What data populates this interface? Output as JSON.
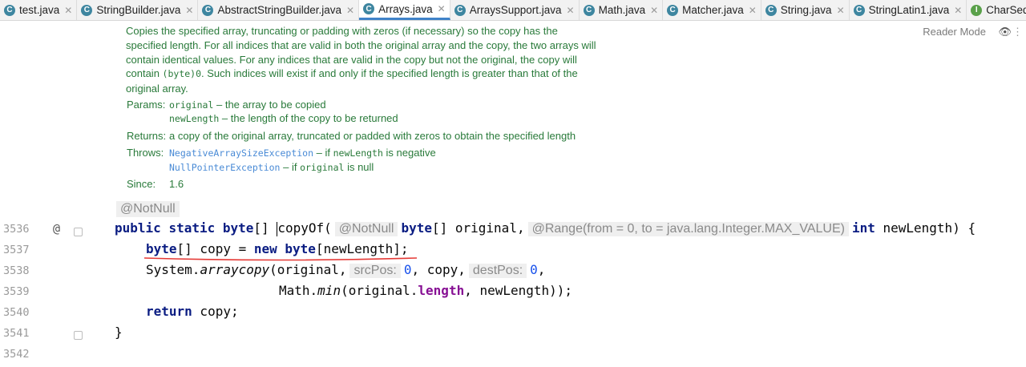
{
  "tabs": [
    {
      "label": "test.java",
      "icon": "C",
      "active": false
    },
    {
      "label": "StringBuilder.java",
      "icon": "C",
      "active": false
    },
    {
      "label": "AbstractStringBuilder.java",
      "icon": "C",
      "active": false
    },
    {
      "label": "Arrays.java",
      "icon": "C",
      "active": true
    },
    {
      "label": "ArraysSupport.java",
      "icon": "C",
      "active": false
    },
    {
      "label": "Math.java",
      "icon": "C",
      "active": false
    },
    {
      "label": "Matcher.java",
      "icon": "C",
      "active": false
    },
    {
      "label": "String.java",
      "icon": "C",
      "active": false
    },
    {
      "label": "StringLatin1.java",
      "icon": "C",
      "active": false
    },
    {
      "label": "CharSequence.ja",
      "icon": "I",
      "active": false
    }
  ],
  "doc": {
    "p1": "Copies the specified array, truncating or padding with zeros (if necessary) so the copy has the specified length. For all indices that are valid in both the original array and the copy, the two arrays will contain identical values. For any indices that are valid in the copy but not the original, the copy will contain ",
    "p1_code": "(byte)0",
    "p1_end": ". Such indices will exist if and only if the specified length is greater than that of the original array.",
    "params_label": "Params:",
    "param1_name": "original",
    "param1_desc": " – the array to be copied",
    "param2_name": "newLength",
    "param2_desc": " – the length of the copy to be returned",
    "returns_label": "Returns:",
    "returns_text": "a copy of the original array, truncated or padded with zeros to obtain the specified length",
    "throws_label": "Throws:",
    "throws1_name": "NegativeArraySizeException",
    "throws1_a": " – if ",
    "throws1_code": "newLength",
    "throws1_b": " is negative",
    "throws2_name": "NullPointerException",
    "throws2_a": " – if ",
    "throws2_code": "original",
    "throws2_b": " is null",
    "since_label": "Since:",
    "since_value": "1.6",
    "reader_mode": "Reader Mode"
  },
  "editor": {
    "line_numbers": [
      "3536",
      "3537",
      "3538",
      "3539",
      "3540",
      "3541",
      "3542"
    ],
    "annotation": "@NotNull",
    "l3536": {
      "kw1": "public",
      "kw2": "static",
      "kw3": "byte",
      "t1": "[] ",
      "t2": "copyOf(",
      "hint1": "@NotNull",
      "kw4": "byte",
      "t3": "[] original,",
      "hint2": "@Range(from = 0, to = java.lang.Integer.MAX_VALUE)",
      "kw5": "int",
      "t4": " newLength) {"
    },
    "l3537": {
      "kw1": "byte",
      "t1": "[] copy = ",
      "kw2": "new",
      "sp": " ",
      "kw3": "byte",
      "t2": "[newLength];"
    },
    "l3538": {
      "t1": "System.",
      "it": "arraycopy",
      "t2": "(original,",
      "hint1": "srcPos:",
      "n1": "0",
      "t3": ", copy,",
      "hint2": "destPos:",
      "n2": "0",
      "t4": ","
    },
    "l3539": {
      "t1": "Math.",
      "it": "min",
      "t2": "(original.",
      "fld": "length",
      "t3": ", newLength));"
    },
    "l3540": {
      "kw": "return",
      "t1": " copy;"
    },
    "l3541": {
      "t1": "}"
    }
  },
  "colors": {
    "doc_text": "#297a3a",
    "keyword": "#0a1c82",
    "number": "#1750eb",
    "field": "#871094",
    "underline": "#e53935",
    "active_tab": "#4083c9"
  }
}
